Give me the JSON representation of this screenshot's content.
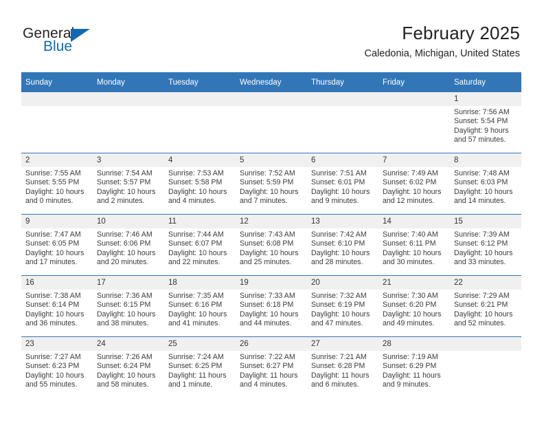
{
  "brand": {
    "name_top": "General",
    "name_bottom": "Blue",
    "accent_color": "#1268b3"
  },
  "header": {
    "title": "February 2025",
    "subtitle": "Caledonia, Michigan, United States",
    "header_bg_color": "#3276b8",
    "daynum_bg_color": "#f0f0f0"
  },
  "calendar": {
    "weekday_headers": [
      "Sunday",
      "Monday",
      "Tuesday",
      "Wednesday",
      "Thursday",
      "Friday",
      "Saturday"
    ],
    "labels": {
      "sunrise": "Sunrise:",
      "sunset": "Sunset:",
      "daylight": "Daylight:"
    },
    "weeks": [
      [
        {
          "day": "",
          "empty": true
        },
        {
          "day": "",
          "empty": true
        },
        {
          "day": "",
          "empty": true
        },
        {
          "day": "",
          "empty": true
        },
        {
          "day": "",
          "empty": true
        },
        {
          "day": "",
          "empty": true
        },
        {
          "day": "1",
          "sunrise": "Sunrise: 7:56 AM",
          "sunset": "Sunset: 5:54 PM",
          "daylight_1": "Daylight: 9 hours",
          "daylight_2": "and 57 minutes."
        }
      ],
      [
        {
          "day": "2",
          "sunrise": "Sunrise: 7:55 AM",
          "sunset": "Sunset: 5:55 PM",
          "daylight_1": "Daylight: 10 hours",
          "daylight_2": "and 0 minutes."
        },
        {
          "day": "3",
          "sunrise": "Sunrise: 7:54 AM",
          "sunset": "Sunset: 5:57 PM",
          "daylight_1": "Daylight: 10 hours",
          "daylight_2": "and 2 minutes."
        },
        {
          "day": "4",
          "sunrise": "Sunrise: 7:53 AM",
          "sunset": "Sunset: 5:58 PM",
          "daylight_1": "Daylight: 10 hours",
          "daylight_2": "and 4 minutes."
        },
        {
          "day": "5",
          "sunrise": "Sunrise: 7:52 AM",
          "sunset": "Sunset: 5:59 PM",
          "daylight_1": "Daylight: 10 hours",
          "daylight_2": "and 7 minutes."
        },
        {
          "day": "6",
          "sunrise": "Sunrise: 7:51 AM",
          "sunset": "Sunset: 6:01 PM",
          "daylight_1": "Daylight: 10 hours",
          "daylight_2": "and 9 minutes."
        },
        {
          "day": "7",
          "sunrise": "Sunrise: 7:49 AM",
          "sunset": "Sunset: 6:02 PM",
          "daylight_1": "Daylight: 10 hours",
          "daylight_2": "and 12 minutes."
        },
        {
          "day": "8",
          "sunrise": "Sunrise: 7:48 AM",
          "sunset": "Sunset: 6:03 PM",
          "daylight_1": "Daylight: 10 hours",
          "daylight_2": "and 14 minutes."
        }
      ],
      [
        {
          "day": "9",
          "sunrise": "Sunrise: 7:47 AM",
          "sunset": "Sunset: 6:05 PM",
          "daylight_1": "Daylight: 10 hours",
          "daylight_2": "and 17 minutes."
        },
        {
          "day": "10",
          "sunrise": "Sunrise: 7:46 AM",
          "sunset": "Sunset: 6:06 PM",
          "daylight_1": "Daylight: 10 hours",
          "daylight_2": "and 20 minutes."
        },
        {
          "day": "11",
          "sunrise": "Sunrise: 7:44 AM",
          "sunset": "Sunset: 6:07 PM",
          "daylight_1": "Daylight: 10 hours",
          "daylight_2": "and 22 minutes."
        },
        {
          "day": "12",
          "sunrise": "Sunrise: 7:43 AM",
          "sunset": "Sunset: 6:08 PM",
          "daylight_1": "Daylight: 10 hours",
          "daylight_2": "and 25 minutes."
        },
        {
          "day": "13",
          "sunrise": "Sunrise: 7:42 AM",
          "sunset": "Sunset: 6:10 PM",
          "daylight_1": "Daylight: 10 hours",
          "daylight_2": "and 28 minutes."
        },
        {
          "day": "14",
          "sunrise": "Sunrise: 7:40 AM",
          "sunset": "Sunset: 6:11 PM",
          "daylight_1": "Daylight: 10 hours",
          "daylight_2": "and 30 minutes."
        },
        {
          "day": "15",
          "sunrise": "Sunrise: 7:39 AM",
          "sunset": "Sunset: 6:12 PM",
          "daylight_1": "Daylight: 10 hours",
          "daylight_2": "and 33 minutes."
        }
      ],
      [
        {
          "day": "16",
          "sunrise": "Sunrise: 7:38 AM",
          "sunset": "Sunset: 6:14 PM",
          "daylight_1": "Daylight: 10 hours",
          "daylight_2": "and 36 minutes."
        },
        {
          "day": "17",
          "sunrise": "Sunrise: 7:36 AM",
          "sunset": "Sunset: 6:15 PM",
          "daylight_1": "Daylight: 10 hours",
          "daylight_2": "and 38 minutes."
        },
        {
          "day": "18",
          "sunrise": "Sunrise: 7:35 AM",
          "sunset": "Sunset: 6:16 PM",
          "daylight_1": "Daylight: 10 hours",
          "daylight_2": "and 41 minutes."
        },
        {
          "day": "19",
          "sunrise": "Sunrise: 7:33 AM",
          "sunset": "Sunset: 6:18 PM",
          "daylight_1": "Daylight: 10 hours",
          "daylight_2": "and 44 minutes."
        },
        {
          "day": "20",
          "sunrise": "Sunrise: 7:32 AM",
          "sunset": "Sunset: 6:19 PM",
          "daylight_1": "Daylight: 10 hours",
          "daylight_2": "and 47 minutes."
        },
        {
          "day": "21",
          "sunrise": "Sunrise: 7:30 AM",
          "sunset": "Sunset: 6:20 PM",
          "daylight_1": "Daylight: 10 hours",
          "daylight_2": "and 49 minutes."
        },
        {
          "day": "22",
          "sunrise": "Sunrise: 7:29 AM",
          "sunset": "Sunset: 6:21 PM",
          "daylight_1": "Daylight: 10 hours",
          "daylight_2": "and 52 minutes."
        }
      ],
      [
        {
          "day": "23",
          "sunrise": "Sunrise: 7:27 AM",
          "sunset": "Sunset: 6:23 PM",
          "daylight_1": "Daylight: 10 hours",
          "daylight_2": "and 55 minutes."
        },
        {
          "day": "24",
          "sunrise": "Sunrise: 7:26 AM",
          "sunset": "Sunset: 6:24 PM",
          "daylight_1": "Daylight: 10 hours",
          "daylight_2": "and 58 minutes."
        },
        {
          "day": "25",
          "sunrise": "Sunrise: 7:24 AM",
          "sunset": "Sunset: 6:25 PM",
          "daylight_1": "Daylight: 11 hours",
          "daylight_2": "and 1 minute."
        },
        {
          "day": "26",
          "sunrise": "Sunrise: 7:22 AM",
          "sunset": "Sunset: 6:27 PM",
          "daylight_1": "Daylight: 11 hours",
          "daylight_2": "and 4 minutes."
        },
        {
          "day": "27",
          "sunrise": "Sunrise: 7:21 AM",
          "sunset": "Sunset: 6:28 PM",
          "daylight_1": "Daylight: 11 hours",
          "daylight_2": "and 6 minutes."
        },
        {
          "day": "28",
          "sunrise": "Sunrise: 7:19 AM",
          "sunset": "Sunset: 6:29 PM",
          "daylight_1": "Daylight: 11 hours",
          "daylight_2": "and 9 minutes."
        },
        {
          "day": "",
          "empty": true
        }
      ]
    ]
  }
}
